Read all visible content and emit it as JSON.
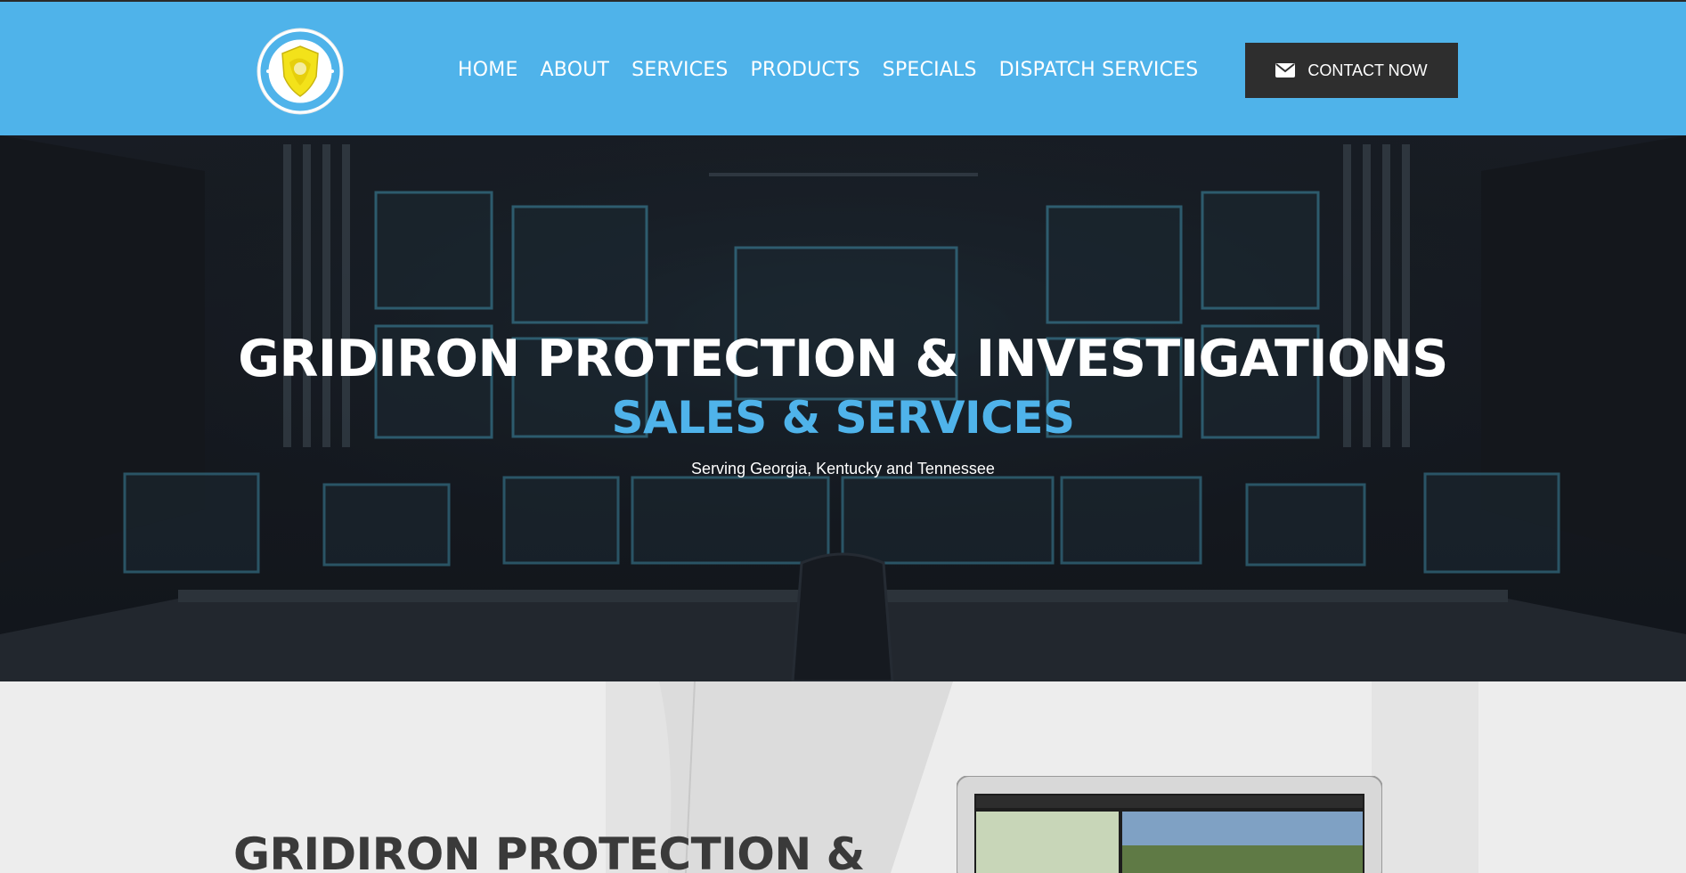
{
  "header": {
    "logo_alt": "GRIDIRON PROTECTION & INVESTIGATIONS AGENCY",
    "nav": [
      {
        "label": "HOME"
      },
      {
        "label": "ABOUT"
      },
      {
        "label": "SERVICES"
      },
      {
        "label": "PRODUCTS"
      },
      {
        "label": "SPECIALS"
      },
      {
        "label": "DISPATCH SERVICES"
      }
    ],
    "contact_button": {
      "label": "CONTACT NOW",
      "icon": "envelope-icon"
    }
  },
  "hero": {
    "title": "GRIDIRON PROTECTION & INVESTIGATIONS",
    "subtitle": "SALES & SERVICES",
    "tagline": "Serving Georgia, Kentucky and Tennessee"
  },
  "section2": {
    "title": "GRIDIRON PROTECTION &"
  },
  "colors": {
    "header_bg": "#4fb3ea",
    "accent": "#4fb3ea",
    "button_bg": "#2e2e2e",
    "hero_bg": "#181c22",
    "section_bg": "#ececec",
    "section_title": "#3a3a3a"
  }
}
